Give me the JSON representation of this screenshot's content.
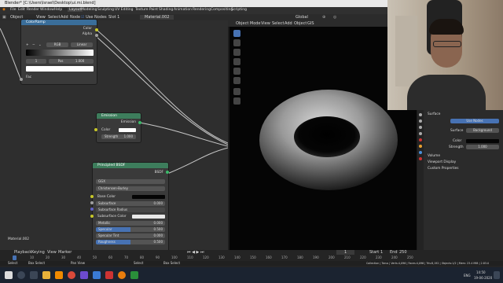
{
  "window": {
    "title": "Blender* [C:\\Users\\Israel\\Desktop\\ui.mi.blend]"
  },
  "menu": [
    "File",
    "Edit",
    "Render",
    "Window",
    "Help"
  ],
  "workspace_tabs": [
    "Layout",
    "Modeling",
    "Sculpting",
    "UV Editing",
    "Texture Paint",
    "Shading",
    "Animation",
    "Rendering",
    "Compositing",
    "Scripting"
  ],
  "editor_header": {
    "object_menu": "Object",
    "view": "View",
    "select": "Select",
    "add": "Add",
    "node": "Node",
    "use_nodes": "Use Nodes",
    "slot": "Slot 1",
    "material": "Material.002"
  },
  "viewport_header": {
    "mode": "Object Mode",
    "view": "View",
    "select": "Select",
    "add": "Add",
    "object": "Object",
    "gis": "GIS",
    "orientation": "Global"
  },
  "colorramp": {
    "title": "ColorRamp",
    "out_color": "Color",
    "out_alpha": "Alpha",
    "mode": "RGB",
    "interp": "Linear",
    "index": "1",
    "pos_label": "Pos",
    "pos_value": "1.000",
    "fac": "Fac"
  },
  "emission": {
    "title": "Emission",
    "output": "Emission",
    "color": "Color",
    "strength_label": "Strength",
    "strength_value": "1.000"
  },
  "bsdf": {
    "title": "Principled BSDF",
    "output": "BSDF",
    "distribution": "GGX",
    "subsurface_method": "Christensen-Burley",
    "rows": [
      {
        "label": "Base Color",
        "value": ""
      },
      {
        "label": "Subsurface",
        "value": "0.000"
      },
      {
        "label": "Subsurface Radius",
        "value": ""
      },
      {
        "label": "Subsurface Color",
        "value": ""
      },
      {
        "label": "Metallic",
        "value": "0.000"
      },
      {
        "label": "Specular",
        "value": "0.500"
      },
      {
        "label": "Specular Tint",
        "value": "0.000"
      },
      {
        "label": "Roughness",
        "value": "0.500"
      }
    ]
  },
  "material_label": "Material.002",
  "properties": {
    "surface_header": "Surface",
    "use_nodes": "Use Nodes",
    "surface_label": "Surface",
    "surface_value": "Background",
    "color_label": "Color",
    "strength_label": "Strength",
    "strength_value": "1.000",
    "sections": [
      "Volume",
      "Viewport Display",
      "Custom Properties"
    ]
  },
  "timeline": {
    "menus": [
      "Playback",
      "Keying",
      "View",
      "Marker"
    ],
    "current_frame": "1",
    "start_label": "Start",
    "start": "1",
    "end_label": "End",
    "end": "250",
    "ticks": [
      "0",
      "10",
      "20",
      "30",
      "40",
      "50",
      "60",
      "70",
      "80",
      "90",
      "100",
      "110",
      "120",
      "130",
      "140",
      "150",
      "160",
      "170",
      "180",
      "190",
      "200",
      "210",
      "220",
      "230",
      "240",
      "250"
    ]
  },
  "status": {
    "left": "Select",
    "mid1": "Box Select",
    "mid2": "Pan View",
    "mid3": "Select",
    "mid4": "Box Select",
    "stats": "Collection | Torus | Verts:4,096 | Faces:4,096 | Tris:8,192 | Objects:1/2 | Mem: 23.4 MiB | 2.83.0"
  },
  "taskbar": {
    "lang": "ENG",
    "time": "14:50",
    "date": "19-06-2020"
  },
  "colors": {
    "emission_head": "#3d7d5c",
    "bsdf_head": "#3d7d5c",
    "colorramp_head": "#3a6e9a",
    "accent": "#4772b3"
  }
}
